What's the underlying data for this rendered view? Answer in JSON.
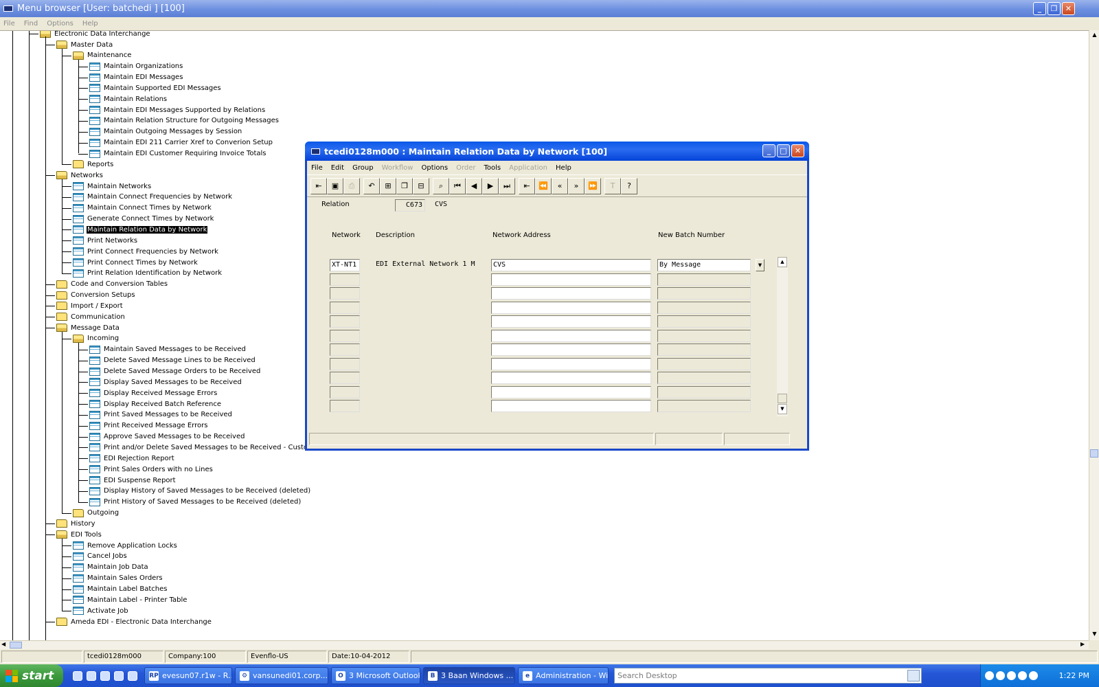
{
  "app": {
    "title": "Menu browser [User: batchedi    ] [100]",
    "menu": [
      "File",
      "Find",
      "Options",
      "Help"
    ]
  },
  "tree": {
    "root": "Electronic Data Interchange",
    "nodes": [
      {
        "label": "Master Data",
        "type": "folder-open",
        "level": 1
      },
      {
        "label": "Maintenance",
        "type": "folder-open",
        "level": 2
      },
      {
        "label": "Maintain Organizations",
        "type": "session",
        "level": 3
      },
      {
        "label": "Maintain EDI Messages",
        "type": "session",
        "level": 3
      },
      {
        "label": "Maintain Supported EDI Messages",
        "type": "session",
        "level": 3
      },
      {
        "label": "Maintain Relations",
        "type": "session",
        "level": 3
      },
      {
        "label": "Maintain EDI Messages Supported by Relations",
        "type": "session",
        "level": 3
      },
      {
        "label": "Maintain Relation Structure for Outgoing Messages",
        "type": "session",
        "level": 3
      },
      {
        "label": "Maintain Outgoing Messages by Session",
        "type": "session",
        "level": 3
      },
      {
        "label": "Maintain EDI 211 Carrier Xref to Converion Setup",
        "type": "session",
        "level": 3
      },
      {
        "label": "Maintain EDI Customer Requiring Invoice Totals",
        "type": "session",
        "level": 3
      },
      {
        "label": "Reports",
        "type": "folder",
        "level": 2
      },
      {
        "label": "Networks",
        "type": "folder-open",
        "level": 1
      },
      {
        "label": "Maintain Networks",
        "type": "session",
        "level": 2
      },
      {
        "label": "Maintain Connect Frequencies by Network",
        "type": "session",
        "level": 2
      },
      {
        "label": "Maintain Connect Times by Network",
        "type": "session",
        "level": 2
      },
      {
        "label": "Generate Connect Times by Network",
        "type": "session",
        "level": 2
      },
      {
        "label": "Maintain Relation Data by Network",
        "type": "session",
        "level": 2,
        "selected": true
      },
      {
        "label": "Print Networks",
        "type": "session",
        "level": 2
      },
      {
        "label": "Print Connect Frequencies by Network",
        "type": "session",
        "level": 2
      },
      {
        "label": "Print Connect Times by Network",
        "type": "session",
        "level": 2
      },
      {
        "label": "Print Relation Identification by Network",
        "type": "session",
        "level": 2
      },
      {
        "label": "Code and Conversion Tables",
        "type": "folder",
        "level": 1
      },
      {
        "label": "Conversion Setups",
        "type": "folder",
        "level": 1
      },
      {
        "label": "Import / Export",
        "type": "folder",
        "level": 1
      },
      {
        "label": "Communication",
        "type": "folder",
        "level": 1
      },
      {
        "label": "Message Data",
        "type": "folder-open",
        "level": 1
      },
      {
        "label": "Incoming",
        "type": "folder-open",
        "level": 2
      },
      {
        "label": "Maintain Saved Messages to be Received",
        "type": "session",
        "level": 3
      },
      {
        "label": "Delete Saved Message Lines to be Received",
        "type": "session",
        "level": 3
      },
      {
        "label": "Delete Saved Message Orders to be Received",
        "type": "session",
        "level": 3
      },
      {
        "label": "Display Saved Messages to be Received",
        "type": "session",
        "level": 3
      },
      {
        "label": "Display Received Message Errors",
        "type": "session",
        "level": 3
      },
      {
        "label": "Display Received Batch Reference",
        "type": "session",
        "level": 3
      },
      {
        "label": "Print Saved Messages to be Received",
        "type": "session",
        "level": 3
      },
      {
        "label": "Print Received Message Errors",
        "type": "session",
        "level": 3
      },
      {
        "label": "Approve Saved Messages to be Received",
        "type": "session",
        "level": 3
      },
      {
        "label": "Print and/or Delete Saved Messages to be Received - Custom",
        "type": "session",
        "level": 3
      },
      {
        "label": "EDI Rejection Report",
        "type": "session",
        "level": 3
      },
      {
        "label": "Print Sales Orders with no Lines",
        "type": "session",
        "level": 3
      },
      {
        "label": "EDI Suspense Report",
        "type": "session",
        "level": 3
      },
      {
        "label": "Display History of Saved Messages to be Received (deleted)",
        "type": "session",
        "level": 3
      },
      {
        "label": "Print History of Saved Messages to be Received (deleted)",
        "type": "session",
        "level": 3
      },
      {
        "label": "Outgoing",
        "type": "folder",
        "level": 2
      },
      {
        "label": "History",
        "type": "folder",
        "level": 1
      },
      {
        "label": "EDI Tools",
        "type": "folder-open",
        "level": 1
      },
      {
        "label": "Remove Application Locks",
        "type": "session",
        "level": 2
      },
      {
        "label": "Cancel Jobs",
        "type": "session",
        "level": 2
      },
      {
        "label": "Maintain Job Data",
        "type": "session",
        "level": 2
      },
      {
        "label": "Maintain Sales Orders",
        "type": "session",
        "level": 2
      },
      {
        "label": "Maintain Label Batches",
        "type": "session",
        "level": 2
      },
      {
        "label": "Maintain Label - Printer Table",
        "type": "session",
        "level": 2
      },
      {
        "label": "Activate Job",
        "type": "session",
        "level": 2
      },
      {
        "label": "Ameda EDI - Electronic Data Interchange",
        "type": "folder",
        "level": 1
      }
    ]
  },
  "status": [
    "",
    "tcedi0128m000",
    "Company:100",
    "Evenflo-US",
    "Date:10-04-2012",
    ""
  ],
  "dialog": {
    "title": "tcedi0128m000 : Maintain Relation Data by Network [100]",
    "menu": [
      {
        "label": "File",
        "enabled": true
      },
      {
        "label": "Edit",
        "enabled": true
      },
      {
        "label": "Group",
        "enabled": true
      },
      {
        "label": "Workflow",
        "enabled": false
      },
      {
        "label": "Options",
        "enabled": true
      },
      {
        "label": "Order",
        "enabled": false
      },
      {
        "label": "Tools",
        "enabled": true
      },
      {
        "label": "Application",
        "enabled": false
      },
      {
        "label": "Help",
        "enabled": true
      }
    ],
    "toolbar": [
      {
        "icon": "exit-icon",
        "glyph": "⇤",
        "enabled": true
      },
      {
        "icon": "save-icon",
        "glyph": "▣",
        "enabled": true
      },
      {
        "icon": "print-icon",
        "glyph": "⎙",
        "enabled": false
      },
      {
        "icon": "undo-icon",
        "glyph": "↶",
        "enabled": true,
        "gap": true
      },
      {
        "icon": "insert-record-icon",
        "glyph": "⊞",
        "enabled": true
      },
      {
        "icon": "duplicate-record-icon",
        "glyph": "❐",
        "enabled": true
      },
      {
        "icon": "delete-record-icon",
        "glyph": "⊟",
        "enabled": true
      },
      {
        "icon": "find-icon",
        "glyph": "⌕",
        "enabled": true,
        "gap": true
      },
      {
        "icon": "first-record-icon",
        "glyph": "⏮",
        "enabled": true
      },
      {
        "icon": "previous-record-icon",
        "glyph": "◀",
        "enabled": true
      },
      {
        "icon": "next-record-icon",
        "glyph": "▶",
        "enabled": true
      },
      {
        "icon": "last-record-icon",
        "glyph": "⏭",
        "enabled": true
      },
      {
        "icon": "first-set-icon",
        "glyph": "⇤",
        "enabled": true,
        "gap": true
      },
      {
        "icon": "previous-set-icon",
        "glyph": "⏪",
        "enabled": true
      },
      {
        "icon": "page-back-icon",
        "glyph": "«",
        "enabled": true
      },
      {
        "icon": "page-forward-icon",
        "glyph": "»",
        "enabled": true
      },
      {
        "icon": "last-set-icon",
        "glyph": "⏩",
        "enabled": true
      },
      {
        "icon": "text-icon",
        "glyph": "T",
        "enabled": false,
        "gap": true
      },
      {
        "icon": "context-help-icon",
        "glyph": "?",
        "enabled": true
      }
    ],
    "relation_label": "Relation",
    "relation_code": "C673",
    "relation_name": "CVS",
    "columns": [
      "Network",
      "Description",
      "Network Address",
      "New Batch Number"
    ],
    "rows": [
      {
        "network": "XT-NT1",
        "description": "EDI External Network 1 M",
        "address": "CVS",
        "batch": "By Message"
      },
      {
        "network": "",
        "description": "",
        "address": "",
        "batch": ""
      },
      {
        "network": "",
        "description": "",
        "address": "",
        "batch": ""
      },
      {
        "network": "",
        "description": "",
        "address": "",
        "batch": ""
      },
      {
        "network": "",
        "description": "",
        "address": "",
        "batch": ""
      },
      {
        "network": "",
        "description": "",
        "address": "",
        "batch": ""
      },
      {
        "network": "",
        "description": "",
        "address": "",
        "batch": ""
      },
      {
        "network": "",
        "description": "",
        "address": "",
        "batch": ""
      },
      {
        "network": "",
        "description": "",
        "address": "",
        "batch": ""
      },
      {
        "network": "",
        "description": "",
        "address": "",
        "batch": ""
      },
      {
        "network": "",
        "description": "",
        "address": "",
        "batch": ""
      }
    ]
  },
  "taskbar": {
    "start": "start",
    "buttons": [
      {
        "label": "evesun07.r1w - R...",
        "icon": "RP"
      },
      {
        "label": "vansunedi01.corp....",
        "icon": "⚙"
      },
      {
        "label": "3 Microsoft Outlook",
        "icon": "O"
      },
      {
        "label": "3 Baan Windows ...",
        "icon": "B",
        "active": true
      },
      {
        "label": "Administration - Wi...",
        "icon": "e"
      }
    ],
    "search_placeholder": "Search Desktop",
    "clock": "1:22 PM"
  }
}
